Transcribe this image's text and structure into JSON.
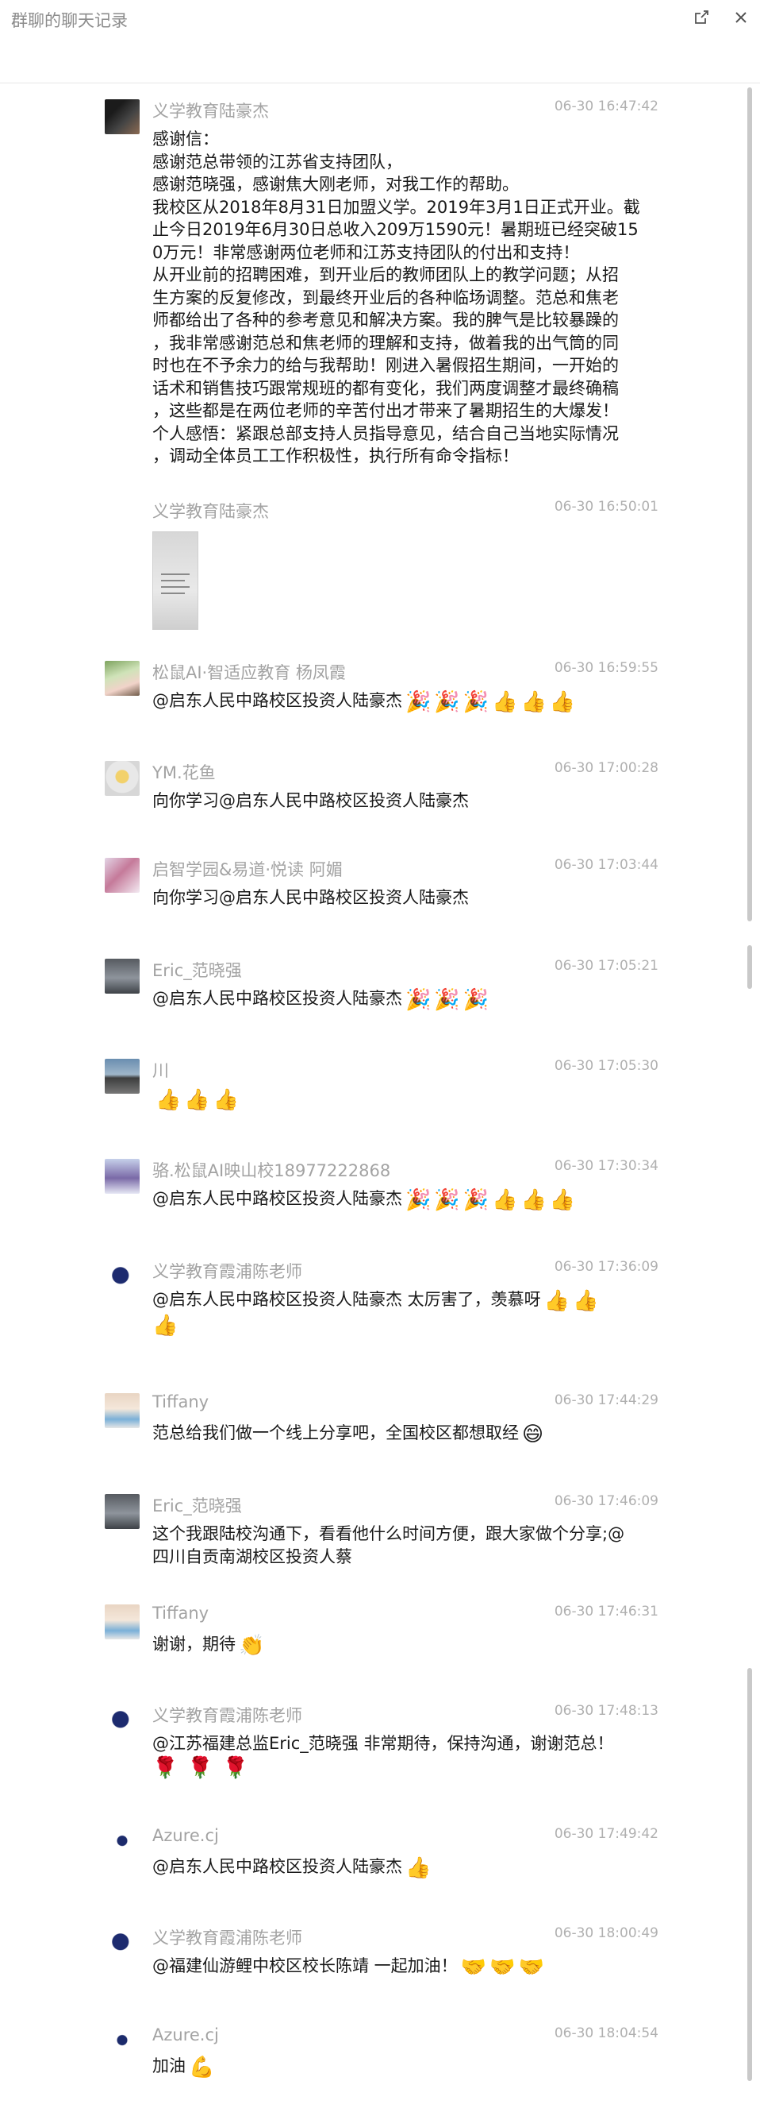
{
  "window": {
    "title": "群聊的聊天记录"
  },
  "messages": [
    {
      "sender": "义学教育陆豪杰",
      "time": "06-30 16:47:42",
      "avatar": "av-a",
      "lines": [
        "感谢信：",
        "感谢范总带领的江苏省支持团队，",
        "感谢范晓强，感谢焦大刚老师，对我工作的帮助。",
        "我校区从2018年8月31日加盟义学。2019年3月1日正式开业。截",
        "止今日2019年6月30日总收入209万1590元！暑期班已经突破15",
        "0万元！非常感谢两位老师和江苏支持团队的付出和支持！",
        "从开业前的招聘困难，到开业后的教师团队上的教学问题；从招",
        "生方案的反复修改，到最终开业后的各种临场调整。范总和焦老",
        "师都给出了各种的参考意见和解决方案。我的脾气是比较暴躁的",
        "，我非常感谢范总和焦老师的理解和支持，做着我的出气筒的同",
        "时也在不予余力的给与我帮助！刚进入暑假招生期间，一开始的",
        "话术和销售技巧跟常规班的都有变化，我们两度调整才最终确稿",
        "，这些都是在两位老师的辛苦付出才带来了暑期招生的大爆发！",
        "个人感悟：紧跟总部支持人员指导意见，结合自己当地实际情况",
        "，调动全体员工工作积极性，执行所有命令指标！"
      ]
    },
    {
      "sender": "义学教育陆豪杰",
      "time": "06-30 16:50:01",
      "avatar": "",
      "image": "thumbnail-image"
    },
    {
      "sender": "松鼠AI·智适应教育 杨凤霞",
      "time": "06-30 16:59:55",
      "avatar": "av-b",
      "lines": [
        "@启东人民中路校区投资人陆豪杰"
      ],
      "emoji": [
        "🎉",
        "🎉",
        "🎉",
        "👍",
        "👍",
        "👍"
      ]
    },
    {
      "sender": "YM.花鱼",
      "time": "06-30 17:00:28",
      "avatar": "av-c",
      "lines": [
        "向你学习@启东人民中路校区投资人陆豪杰"
      ]
    },
    {
      "sender": "启智学园&易道·悦读 阿媚",
      "time": "06-30 17:03:44",
      "avatar": "av-d",
      "lines": [
        "向你学习@启东人民中路校区投资人陆豪杰"
      ]
    },
    {
      "sender": "Eric_范晓强",
      "time": "06-30 17:05:21",
      "avatar": "av-e",
      "lines": [
        "@启东人民中路校区投资人陆豪杰"
      ],
      "emoji": [
        "🎉",
        "🎉",
        "🎉"
      ]
    },
    {
      "sender": "川",
      "time": "06-30 17:05:30",
      "avatar": "av-f",
      "lines": [
        ""
      ],
      "emoji": [
        "👍",
        "👍",
        "👍"
      ]
    },
    {
      "sender": "骆.松鼠AI映山校18977222868",
      "time": "06-30 17:30:34",
      "avatar": "av-g",
      "lines": [
        "@启东人民中路校区投资人陆豪杰"
      ],
      "emoji": [
        "🎉",
        "🎉",
        "🎉",
        "👍",
        "👍",
        "👍"
      ]
    },
    {
      "sender": "义学教育霞浦陈老师",
      "time": "06-30 17:36:09",
      "avatar": "av-h",
      "lines": [
        "@启东人民中路校区投资人陆豪杰 太厉害了，羡慕呀"
      ],
      "emoji": [
        "👍",
        "👍"
      ],
      "line2_emoji": [
        "👍"
      ]
    },
    {
      "sender": "Tiffany",
      "time": "06-30 17:44:29",
      "avatar": "av-i",
      "lines": [
        "范总给我们做一个线上分享吧，全国校区都想取经"
      ],
      "emoji": [
        "😄"
      ]
    },
    {
      "sender": "Eric_范晓强",
      "time": "06-30 17:46:09",
      "avatar": "av-e",
      "lines": [
        "这个我跟陆校沟通下，看看他什么时间方便，跟大家做个分享;@",
        "四川自贡南湖校区投资人蔡"
      ]
    },
    {
      "sender": "Tiffany",
      "time": "06-30 17:46:31",
      "avatar": "av-i",
      "lines": [
        "谢谢，期待"
      ],
      "emoji": [
        "👏"
      ]
    },
    {
      "sender": "义学教育霞浦陈老师",
      "time": "06-30 17:48:13",
      "avatar": "av-h",
      "lines": [
        "@江苏福建总监Eric_范晓强 非常期待，保持沟通，谢谢范总！"
      ],
      "line2_emoji": [
        "🌹",
        "🌹",
        "🌹"
      ]
    },
    {
      "sender": "Azure.cj",
      "time": "06-30 17:49:42",
      "avatar": "av-j",
      "lines": [
        "@启东人民中路校区投资人陆豪杰"
      ],
      "emoji": [
        "👍"
      ]
    },
    {
      "sender": "义学教育霞浦陈老师",
      "time": "06-30 18:00:49",
      "avatar": "av-h",
      "lines": [
        "@福建仙游鲤中校区校长陈靖 一起加油！"
      ],
      "emoji": [
        "🤝",
        "🤝",
        "🤝"
      ]
    },
    {
      "sender": "Azure.cj",
      "time": "06-30 18:04:54",
      "avatar": "av-j",
      "lines": [
        "加油"
      ],
      "emoji": [
        "💪"
      ]
    }
  ]
}
